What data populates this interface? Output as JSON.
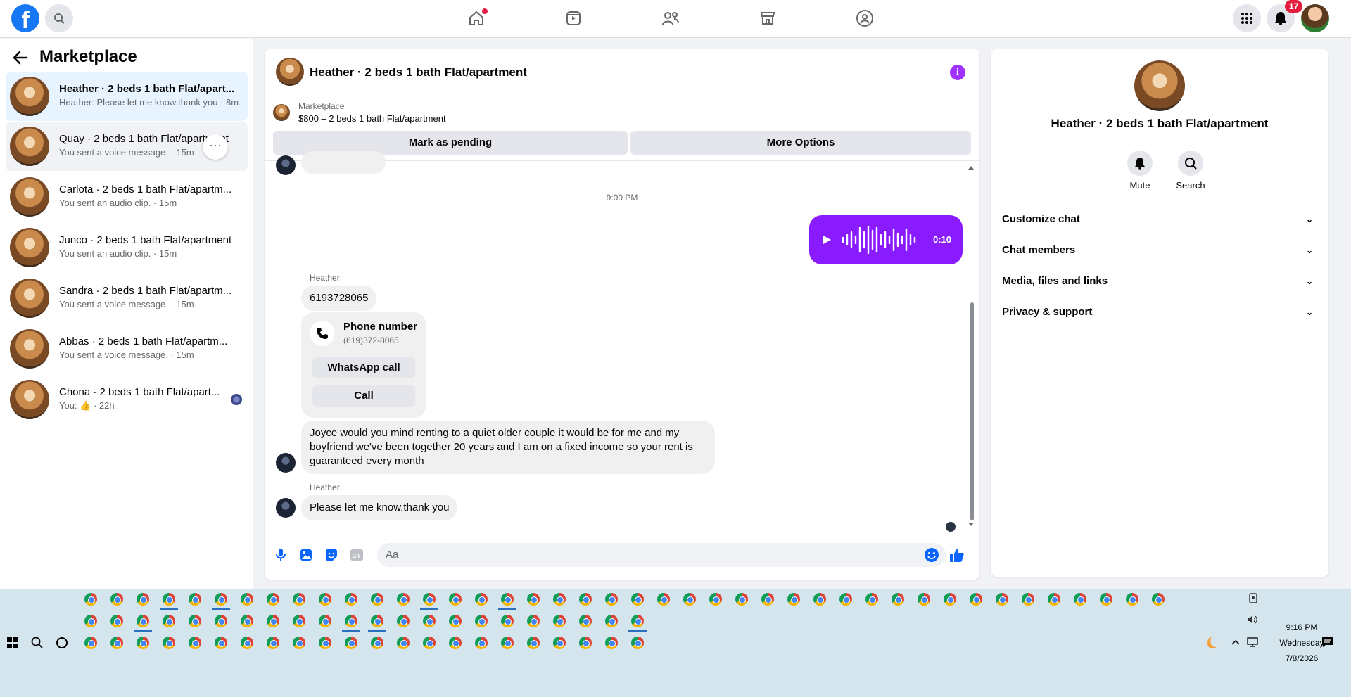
{
  "topbar": {
    "logo": "f",
    "notification_count": "17",
    "icons": [
      "home-icon",
      "video-icon",
      "friends-icon",
      "marketplace-icon",
      "groups-icon"
    ]
  },
  "sidebar": {
    "title": "Marketplace",
    "conversations": [
      {
        "name": "Heather · 2 beds 1 bath Flat/apart...",
        "sub": "Heather: Please let me know.thank you · 8m"
      },
      {
        "name": "Quay · 2 beds 1 bath Flat/apartment",
        "sub": "You sent a voice message. · 15m"
      },
      {
        "name": "Carlota · 2 beds 1 bath Flat/apartm...",
        "sub": "You sent an audio clip. · 15m"
      },
      {
        "name": "Junco · 2 beds 1 bath Flat/apartment",
        "sub": "You sent an audio clip. · 15m"
      },
      {
        "name": "Sandra · 2 beds 1 bath Flat/apartm...",
        "sub": "You sent a voice message. · 15m"
      },
      {
        "name": "Abbas · 2 beds 1 bath Flat/apartm...",
        "sub": "You sent a voice message. · 15m"
      },
      {
        "name": "Chona · 2 beds 1 bath Flat/apart...",
        "sub": "You: 👍 · 22h"
      }
    ]
  },
  "chat": {
    "title": "Heather · 2 beds 1 bath Flat/apartment",
    "marketplace_label": "Marketplace",
    "listing": "$800 – 2 beds 1 bath Flat/apartment",
    "mark_pending": "Mark as pending",
    "more_options": "More Options",
    "time": "9:00 PM",
    "voice_duration": "0:10",
    "sender1": "Heather",
    "msg_phone": "6193728065",
    "phone_card_title": "Phone number",
    "phone_card_number": "(619)372-8065",
    "whatsapp_call": "WhatsApp call",
    "call": "Call",
    "msg_long": "Joyce would you mind renting to a quiet older couple it would be for me and my boyfriend we've been together 20 years and I am on a fixed income so your rent is guaranteed every month",
    "sender2": "Heather",
    "msg_last": "Please let me know.thank you",
    "composer_placeholder": "Aa"
  },
  "right_panel": {
    "name": "Heather · 2 beds 1 bath Flat/apartment",
    "mute": "Mute",
    "search": "Search",
    "rows": [
      "Customize chat",
      "Chat members",
      "Media, files and links",
      "Privacy & support"
    ]
  },
  "taskbar": {
    "time": "9:16 PM",
    "day": "Wednesday",
    "date": "7/8/2026"
  }
}
